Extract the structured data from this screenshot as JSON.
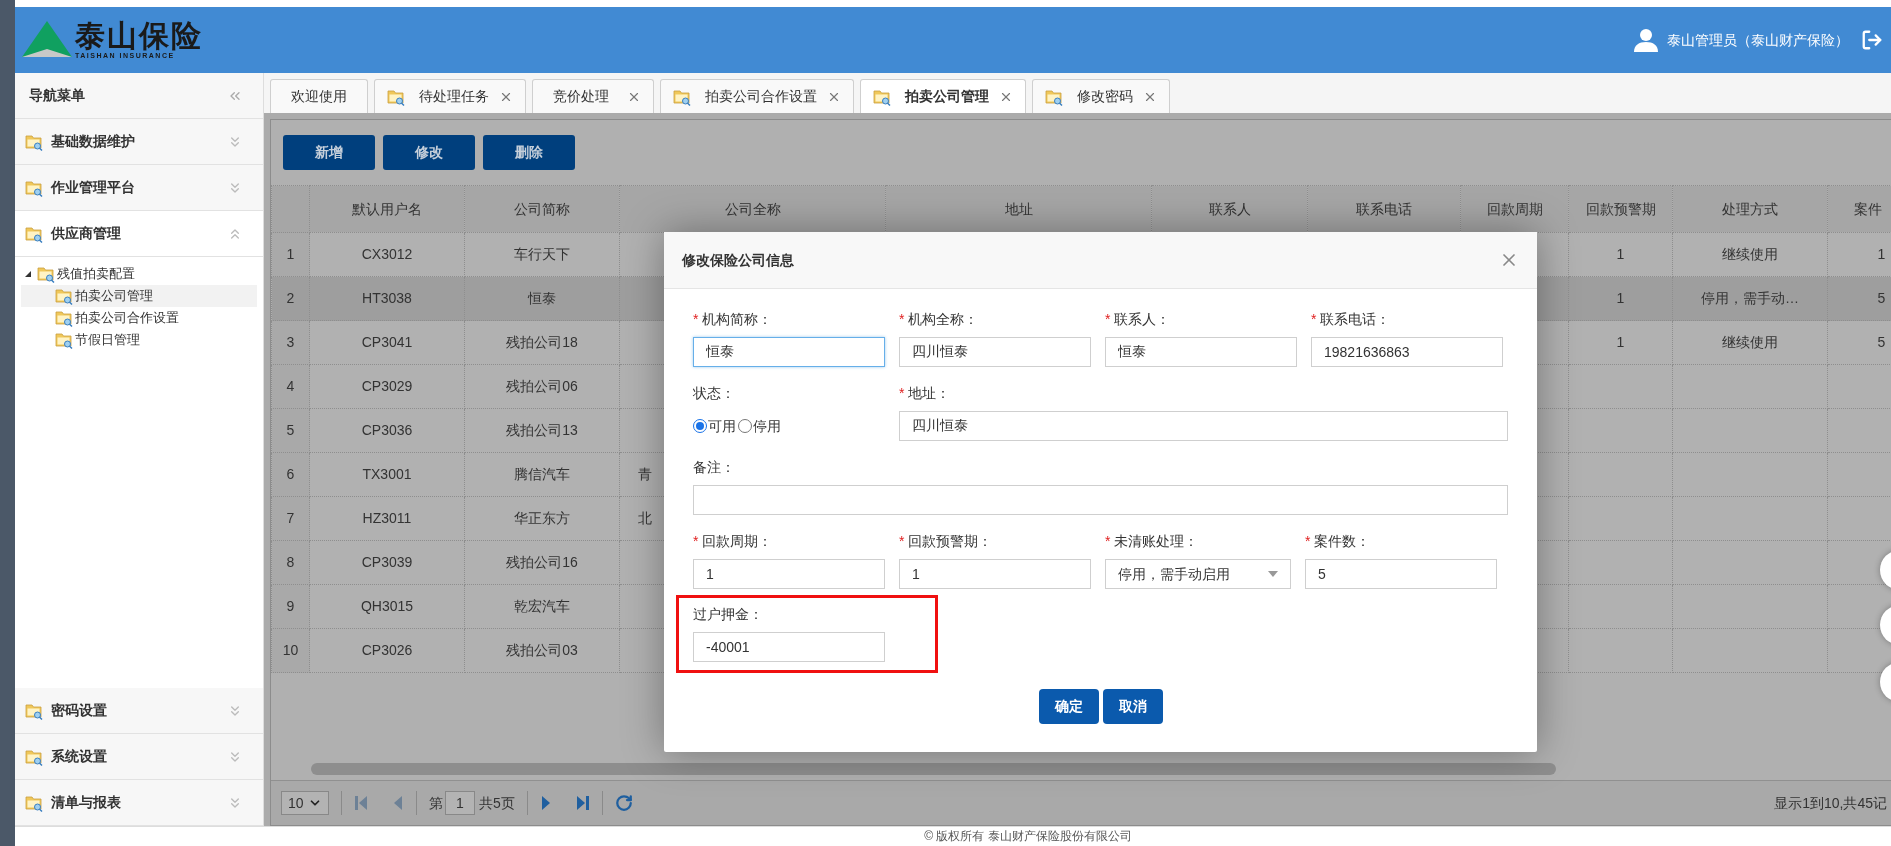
{
  "header": {
    "logo": {
      "name": "泰山保险",
      "subtitle": "TAISHAN INSURANCE"
    },
    "user": "泰山管理员（泰山财产保险）"
  },
  "sidebar": {
    "title": "导航菜单",
    "sections": [
      {
        "label": "基础数据维护",
        "expanded": false
      },
      {
        "label": "作业管理平台",
        "expanded": false
      },
      {
        "label": "供应商管理",
        "expanded": true,
        "tree": [
          {
            "label": "残值拍卖配置",
            "expanded": true,
            "selected": false,
            "children": [
              {
                "label": "拍卖公司管理",
                "selected": true
              },
              {
                "label": "拍卖公司合作设置",
                "selected": false
              },
              {
                "label": "节假日管理",
                "selected": false
              }
            ]
          }
        ]
      },
      {
        "label": "密码设置",
        "expanded": false
      },
      {
        "label": "系统设置",
        "expanded": false
      },
      {
        "label": "清单与报表",
        "expanded": false
      }
    ]
  },
  "tabs": [
    {
      "label": "欢迎使用",
      "kind": "plain",
      "closable": false,
      "selected": false
    },
    {
      "label": "待处理任务",
      "kind": "folder",
      "closable": true,
      "selected": false
    },
    {
      "label": "竞价处理",
      "kind": "plain",
      "closable": true,
      "selected": false
    },
    {
      "label": "拍卖公司合作设置",
      "kind": "folder",
      "closable": true,
      "selected": false
    },
    {
      "label": "拍卖公司管理",
      "kind": "folder",
      "closable": true,
      "selected": true
    },
    {
      "label": "修改密码",
      "kind": "folder",
      "closable": true,
      "selected": false
    }
  ],
  "toolbar": [
    "新增",
    "修改",
    "删除"
  ],
  "table": {
    "columns": [
      {
        "label": "默认用户名"
      },
      {
        "label": "公司简称"
      },
      {
        "label": "公司全称"
      },
      {
        "label": "地址"
      },
      {
        "label": "联系人"
      },
      {
        "label": "联系电话"
      },
      {
        "label": "回款周期"
      },
      {
        "label": "回款预警期"
      },
      {
        "label": "处理方式"
      },
      {
        "label": "案件"
      }
    ],
    "rows": [
      {
        "number": "1",
        "selected": false,
        "username": "CX3012",
        "short_name": "车行天下",
        "warning": "1",
        "handling": "继续使用",
        "cases": "1"
      },
      {
        "number": "2",
        "selected": true,
        "username": "HT3038",
        "short_name": "恒泰",
        "warning": "1",
        "handling": "停用，需手动…",
        "cases": "5"
      },
      {
        "number": "3",
        "selected": false,
        "username": "CP3041",
        "short_name": "残拍公司18",
        "warning": "1",
        "handling": "继续使用",
        "cases": "5"
      },
      {
        "number": "4",
        "selected": false,
        "username": "CP3029",
        "short_name": "残拍公司06"
      },
      {
        "number": "5",
        "selected": false,
        "username": "CP3036",
        "short_name": "残拍公司13"
      },
      {
        "number": "6",
        "selected": false,
        "username": "TX3001",
        "short_name": "腾信汽车",
        "full_name": "青"
      },
      {
        "number": "7",
        "selected": false,
        "username": "HZ3011",
        "short_name": "华正东方",
        "full_name": "北"
      },
      {
        "number": "8",
        "selected": false,
        "username": "CP3039",
        "short_name": "残拍公司16"
      },
      {
        "number": "9",
        "selected": false,
        "username": "QH3015",
        "short_name": "乾宏汽车"
      },
      {
        "number": "10",
        "selected": false,
        "username": "CP3026",
        "short_name": "残拍公司03"
      }
    ]
  },
  "pagination": {
    "page_size": "10",
    "page_prefix": "第",
    "page": "1",
    "page_total": "共5页",
    "info": "显示1到10,共45记"
  },
  "modal": {
    "title": "修改保险公司信息",
    "rows": [
      [
        {
          "kind": "text",
          "mark": "*",
          "label": "机构简称：",
          "value": "恒泰",
          "focused": true
        },
        {
          "kind": "text",
          "mark": "*",
          "label": "机构全称：",
          "value": "四川恒泰",
          "focused": false
        },
        {
          "kind": "text",
          "mark": "*",
          "label": "联系人：",
          "value": "恒泰",
          "focused": false
        },
        {
          "kind": "text",
          "mark": "*",
          "label": "联系电话：",
          "value": "19821636863",
          "focused": false
        }
      ],
      [
        {
          "kind": "radio",
          "label": "状态：",
          "options": [
            {
              "label": "可用",
              "selected": true
            },
            {
              "label": "停用",
              "selected": false
            }
          ]
        },
        {
          "kind": "wide",
          "mark": "*",
          "label": "地址：",
          "value": "四川恒泰",
          "focused": false
        }
      ],
      [
        {
          "kind": "wide",
          "label": "备注：",
          "focused": false
        }
      ],
      [
        {
          "kind": "text",
          "mark": "*",
          "label": "回款周期：",
          "value": "1",
          "focused": false
        },
        {
          "kind": "text",
          "mark": "*",
          "label": "回款预警期：",
          "value": "1",
          "focused": false
        },
        {
          "kind": "select",
          "mark": "*",
          "label": "未清账处理：",
          "value": "停用，需手动启用"
        },
        {
          "kind": "text",
          "mark": "*",
          "label": "案件数：",
          "value": "5",
          "focused": false
        }
      ],
      [
        {
          "kind": "text",
          "label": "过户押金：",
          "value": "-40001",
          "focused": false,
          "highlighted": true
        }
      ]
    ],
    "buttons": [
      "确定",
      "取消"
    ]
  },
  "footer": "© 版权所有 泰山财产保险股份有限公司"
}
